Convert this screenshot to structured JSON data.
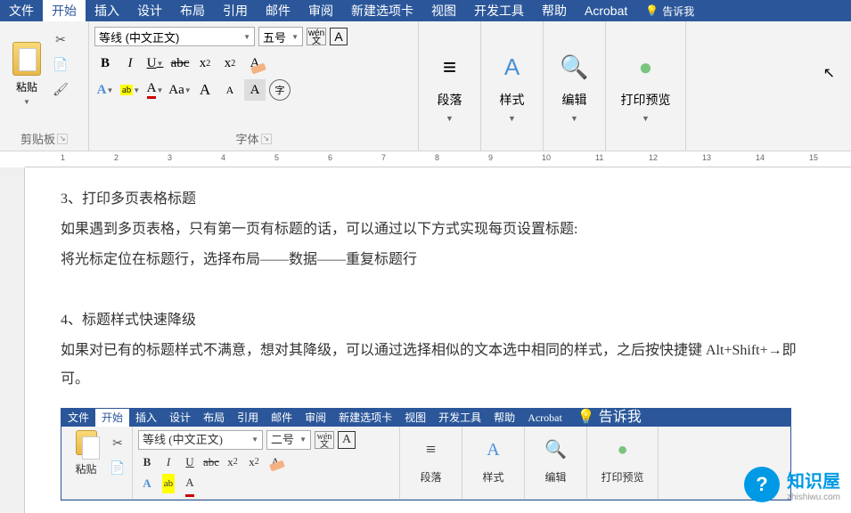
{
  "tabs": [
    "文件",
    "开始",
    "插入",
    "设计",
    "布局",
    "引用",
    "邮件",
    "审阅",
    "新建选项卡",
    "视图",
    "开发工具",
    "帮助",
    "Acrobat"
  ],
  "active_tab": "开始",
  "tell_me": "告诉我",
  "clipboard": {
    "paste": "粘贴",
    "label": "剪贴板"
  },
  "font": {
    "name": "等线 (中文正文)",
    "size": "五号",
    "size_embedded": "二号",
    "label": "字体",
    "ruby_top": "wén",
    "ruby_bottom": "文",
    "border_char": "A",
    "bold": "B",
    "italic": "I",
    "underline": "U",
    "strike": "abc",
    "sub": "x",
    "sub2": "2",
    "sup": "x",
    "sup2": "2",
    "effect": "A",
    "highlight": "ab",
    "color": "A",
    "case": "Aa",
    "grow": "A",
    "shrink": "A",
    "char_shade": "A",
    "enclose": "字"
  },
  "groups": {
    "paragraph": "段落",
    "styles": "样式",
    "editing": "编辑",
    "print_preview": "打印预览"
  },
  "ruler_marks": [
    1,
    2,
    3,
    4,
    5,
    6,
    7,
    8,
    9,
    10,
    11,
    12,
    13,
    14,
    15
  ],
  "document": {
    "p1": "3、打印多页表格标题",
    "p2": "如果遇到多页表格，只有第一页有标题的话，可以通过以下方式实现每页设置标题:",
    "p3": "将光标定位在标题行，选择布局——数据——重复标题行",
    "p4": "4、标题样式快速降级",
    "p5": "如果对已有的标题样式不满意，想对其降级，可以通过选择相似的文本选中相同的样式，之后按快捷键 Alt+Shift+→即可。"
  },
  "watermark": {
    "main": "知识屋",
    "sub": "zhishiwu.com",
    "icon": "?"
  }
}
